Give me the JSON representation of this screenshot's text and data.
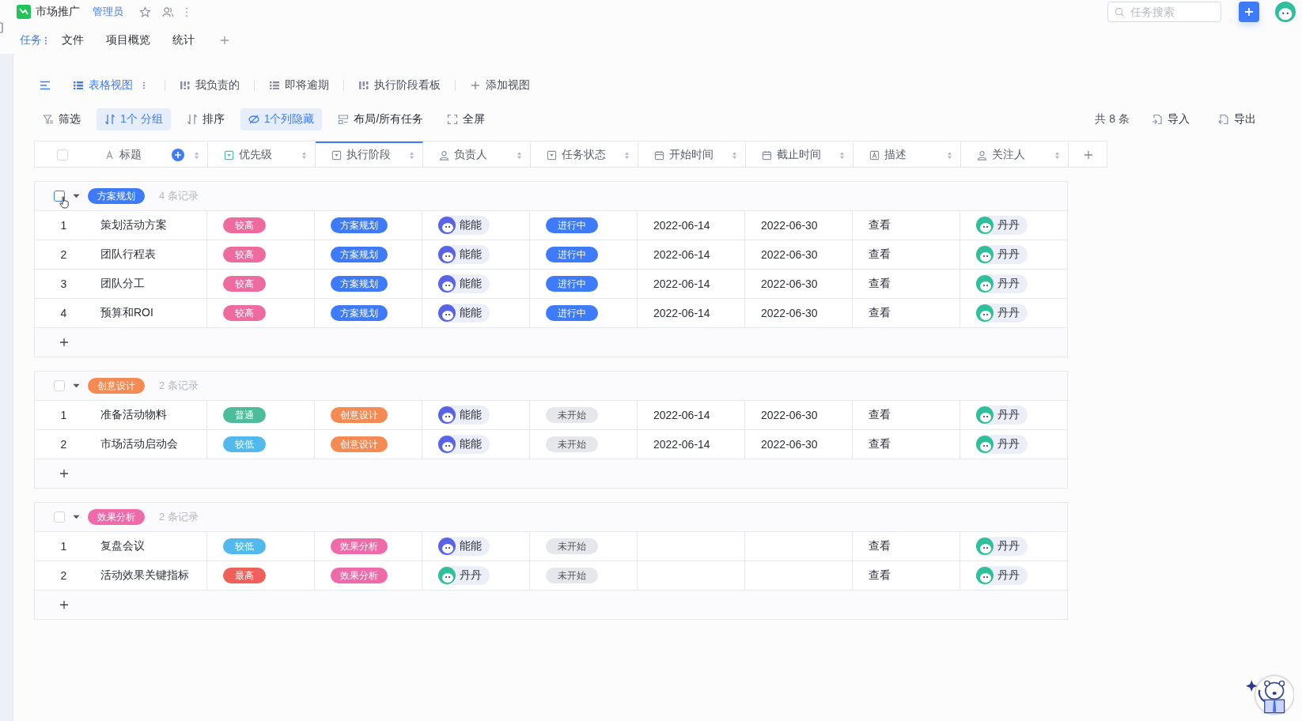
{
  "app": {
    "title": "市场推广",
    "role": "管理员"
  },
  "search": {
    "placeholder": "任务搜索"
  },
  "tabs": [
    {
      "label": "任务",
      "selected": true
    },
    {
      "label": "文件",
      "selected": false
    },
    {
      "label": "项目概览",
      "selected": false
    },
    {
      "label": "统计",
      "selected": false
    }
  ],
  "views": [
    {
      "label": "表格视图",
      "kind": "grid",
      "selected": true
    },
    {
      "label": "我负责的",
      "kind": "board",
      "selected": false
    },
    {
      "label": "即将逾期",
      "kind": "grid",
      "selected": false
    },
    {
      "label": "执行阶段看板",
      "kind": "board",
      "selected": false
    },
    {
      "label": "添加视图",
      "kind": "add",
      "selected": false
    }
  ],
  "toolbar": [
    {
      "label": "筛选",
      "kind": "filter",
      "active": false
    },
    {
      "label": "1个 分组",
      "kind": "group",
      "active": true
    },
    {
      "label": "排序",
      "kind": "sort",
      "active": false
    },
    {
      "label": "1个列隐藏",
      "kind": "hide",
      "active": true
    },
    {
      "label": "布局/所有任务",
      "kind": "layout",
      "active": false
    },
    {
      "label": "全屏",
      "kind": "fullscreen",
      "active": false
    }
  ],
  "total": "共 8 条",
  "import_label": "导入",
  "export_label": "导出",
  "select_all_checked": false,
  "columns": [
    {
      "label": "标题",
      "kind": "text",
      "selected": false
    },
    {
      "label": "优先级",
      "kind": "select_accent",
      "selected": false
    },
    {
      "label": "执行阶段",
      "kind": "select",
      "selected": true
    },
    {
      "label": "负责人",
      "kind": "person",
      "selected": false
    },
    {
      "label": "任务状态",
      "kind": "select",
      "selected": false
    },
    {
      "label": "开始时间",
      "kind": "date",
      "selected": false
    },
    {
      "label": "截止时间",
      "kind": "date",
      "selected": false
    },
    {
      "label": "描述",
      "kind": "long_text",
      "selected": false
    },
    {
      "label": "关注人",
      "kind": "person",
      "selected": false
    }
  ],
  "groups": [
    {
      "tag": "方案规划",
      "color": "#3d7bfa",
      "count": "4 条记录",
      "checked": false,
      "hovered": true,
      "expanded": true,
      "rows": [
        {
          "num": "1",
          "title": "策划活动方案",
          "priority": {
            "label": "较高",
            "color": "#ee6b9f"
          },
          "stage": {
            "label": "方案规划",
            "color": "#3d7bfa"
          },
          "assignee": {
            "name": "能能",
            "color": "#5a63e6"
          },
          "status": {
            "label": "进行中",
            "kind": "in_progress"
          },
          "start": "2022-06-14",
          "end": "2022-06-30",
          "desc": "查看",
          "follower": {
            "name": "丹丹",
            "color": "#2fbf9a"
          }
        },
        {
          "num": "2",
          "title": "团队行程表",
          "priority": {
            "label": "较高",
            "color": "#ee6b9f"
          },
          "stage": {
            "label": "方案规划",
            "color": "#3d7bfa"
          },
          "assignee": {
            "name": "能能",
            "color": "#5a63e6"
          },
          "status": {
            "label": "进行中",
            "kind": "in_progress"
          },
          "start": "2022-06-14",
          "end": "2022-06-30",
          "desc": "查看",
          "follower": {
            "name": "丹丹",
            "color": "#2fbf9a"
          }
        },
        {
          "num": "3",
          "title": "团队分工",
          "priority": {
            "label": "较高",
            "color": "#ee6b9f"
          },
          "stage": {
            "label": "方案规划",
            "color": "#3d7bfa"
          },
          "assignee": {
            "name": "能能",
            "color": "#5a63e6"
          },
          "status": {
            "label": "进行中",
            "kind": "in_progress"
          },
          "start": "2022-06-14",
          "end": "2022-06-30",
          "desc": "查看",
          "follower": {
            "name": "丹丹",
            "color": "#2fbf9a"
          }
        },
        {
          "num": "4",
          "title": "预算和ROI",
          "priority": {
            "label": "较高",
            "color": "#ee6b9f"
          },
          "stage": {
            "label": "方案规划",
            "color": "#3d7bfa"
          },
          "assignee": {
            "name": "能能",
            "color": "#5a63e6"
          },
          "status": {
            "label": "进行中",
            "kind": "in_progress"
          },
          "start": "2022-06-14",
          "end": "2022-06-30",
          "desc": "查看",
          "follower": {
            "name": "丹丹",
            "color": "#2fbf9a"
          }
        }
      ]
    },
    {
      "tag": "创意设计",
      "color": "#f58a52",
      "count": "2 条记录",
      "checked": false,
      "hovered": false,
      "expanded": true,
      "rows": [
        {
          "num": "1",
          "title": "准备活动物料",
          "priority": {
            "label": "普通",
            "color": "#4cbc9a"
          },
          "stage": {
            "label": "创意设计",
            "color": "#f58a52"
          },
          "assignee": {
            "name": "能能",
            "color": "#5a63e6"
          },
          "status": {
            "label": "未开始",
            "kind": "not_started"
          },
          "start": "2022-06-14",
          "end": "2022-06-30",
          "desc": "查看",
          "follower": {
            "name": "丹丹",
            "color": "#2fbf9a"
          }
        },
        {
          "num": "2",
          "title": "市场活动启动会",
          "priority": {
            "label": "较低",
            "color": "#52b9ef"
          },
          "stage": {
            "label": "创意设计",
            "color": "#f58a52"
          },
          "assignee": {
            "name": "能能",
            "color": "#5a63e6"
          },
          "status": {
            "label": "未开始",
            "kind": "not_started"
          },
          "start": "2022-06-14",
          "end": "2022-06-30",
          "desc": "查看",
          "follower": {
            "name": "丹丹",
            "color": "#2fbf9a"
          }
        }
      ]
    },
    {
      "tag": "效果分析",
      "color": "#ee6aa9",
      "count": "2 条记录",
      "checked": false,
      "hovered": false,
      "expanded": true,
      "rows": [
        {
          "num": "1",
          "title": "复盘会议",
          "priority": {
            "label": "较低",
            "color": "#52b9ef"
          },
          "stage": {
            "label": "效果分析",
            "color": "#ee6aa9"
          },
          "assignee": {
            "name": "能能",
            "color": "#5a63e6"
          },
          "status": {
            "label": "未开始",
            "kind": "not_started"
          },
          "desc": "查看",
          "follower": {
            "name": "丹丹",
            "color": "#2fbf9a"
          }
        },
        {
          "num": "2",
          "title": "活动效果关键指标",
          "priority": {
            "label": "最高",
            "color": "#f0605a"
          },
          "stage": {
            "label": "效果分析",
            "color": "#ee6aa9"
          },
          "assignee": {
            "name": "丹丹",
            "color": "#2fbf9a"
          },
          "status": {
            "label": "未开始",
            "kind": "not_started"
          },
          "desc": "查看",
          "follower": {
            "name": "丹丹",
            "color": "#2fbf9a"
          }
        }
      ]
    }
  ]
}
